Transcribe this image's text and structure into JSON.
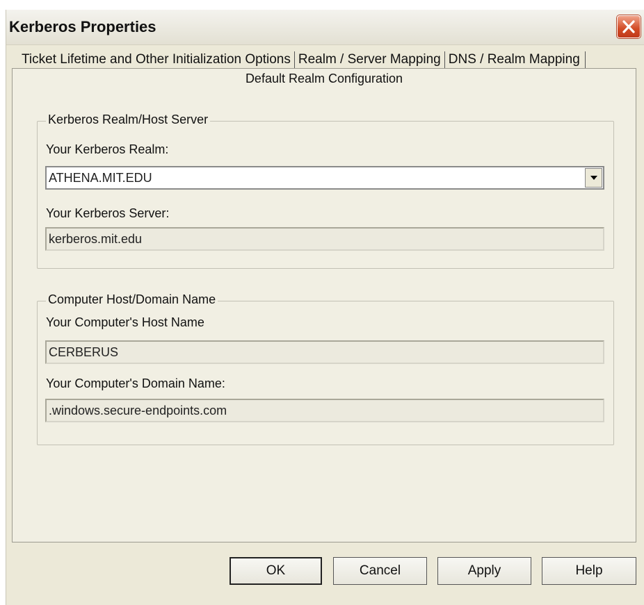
{
  "window": {
    "title": "Kerberos Properties",
    "close_icon": "close-icon"
  },
  "tabs": [
    {
      "label": "Ticket Lifetime and Other Initialization Options"
    },
    {
      "label": "Realm / Server Mapping"
    },
    {
      "label": "DNS / Realm Mapping"
    }
  ],
  "panel": {
    "label": "Default Realm Configuration"
  },
  "realm_group": {
    "legend": "Kerberos Realm/Host Server",
    "realm_label": "Your Kerberos Realm:",
    "realm_value": "ATHENA.MIT.EDU",
    "server_label": "Your Kerberos Server:",
    "server_value": "kerberos.mit.edu"
  },
  "host_group": {
    "legend": "Computer Host/Domain Name",
    "host_label": "Your Computer's Host Name",
    "host_value": "CERBERUS",
    "domain_label": "Your Computer's Domain Name:",
    "domain_value": ".windows.secure-endpoints.com"
  },
  "buttons": {
    "ok": "OK",
    "cancel": "Cancel",
    "apply": "Apply",
    "help": "Help"
  },
  "colors": {
    "dialog_bg": "#ece9d8",
    "close_button": "#d24b25"
  }
}
